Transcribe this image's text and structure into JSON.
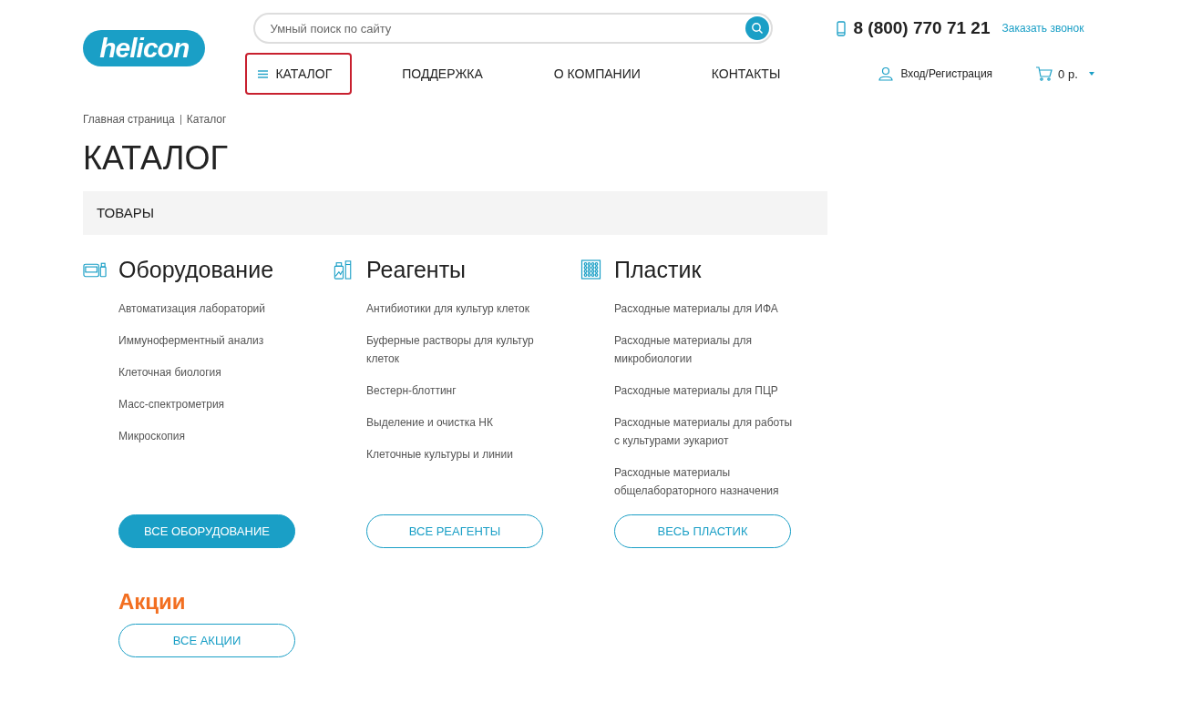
{
  "header": {
    "logo": "helicon",
    "search": {
      "placeholder": "Умный поиск по сайту"
    },
    "phone": "8 (800) 770 71 21",
    "callback_link": "Заказать звонок",
    "login_link": "Вход/Регистрация",
    "cart_total": "0 р."
  },
  "nav": [
    {
      "label": "КАТАЛОГ",
      "selected": true
    },
    {
      "label": "ПОДДЕРЖКА",
      "selected": false
    },
    {
      "label": "О КОМПАНИИ",
      "selected": false
    },
    {
      "label": "КОНТАКТЫ",
      "selected": false
    }
  ],
  "breadcrumbs": [
    "Главная страница",
    "Каталог"
  ],
  "page_title": "КАТАЛОГ",
  "section_title": "ТОВАРЫ",
  "categories": [
    {
      "kind": "equipment",
      "title": "Оборудование",
      "links": [
        "Автоматизация лабораторий",
        "Иммуноферментный анализ",
        "Клеточная биология",
        "Масс-спектрометрия",
        "Микроскопия"
      ],
      "button": {
        "label": "ВСЕ ОБОРУДОВАНИЕ",
        "filled": true
      }
    },
    {
      "kind": "reagents",
      "title": "Реагенты",
      "links": [
        "Антибиотики для культур клеток",
        "Буферные растворы для культур клеток",
        "Вестерн-блоттинг",
        "Выделение и очистка НК",
        "Клеточные культуры и линии"
      ],
      "button": {
        "label": "ВСЕ РЕАГЕНТЫ",
        "filled": false
      }
    },
    {
      "kind": "plastic",
      "title": "Пластик",
      "links": [
        "Расходные материалы для ИФА",
        "Расходные материалы для микробиологии",
        "Расходные материалы для ПЦР",
        "Расходные материалы для работы с культурами эукариот",
        "Расходные материалы общелабораторного назначения"
      ],
      "button": {
        "label": "ВЕСЬ ПЛАСТИК",
        "filled": false
      }
    }
  ],
  "promo": {
    "title": "Акции",
    "button": {
      "label": "ВСЕ АКЦИИ",
      "filled": false
    }
  }
}
